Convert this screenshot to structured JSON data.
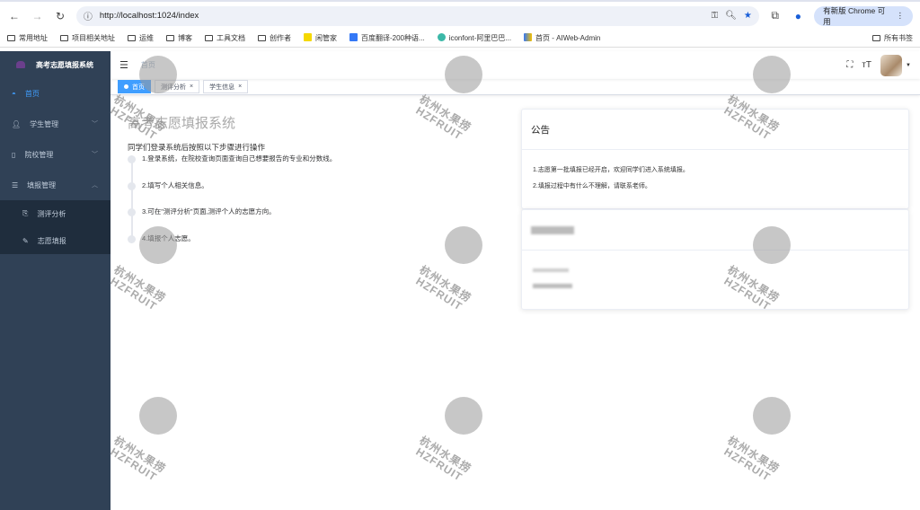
{
  "browser": {
    "url": "http://localhost:1024/index",
    "update_label": "有新版 Chrome 可用",
    "bookmarks": [
      "常用地址",
      "项目相关地址",
      "运维",
      "博客",
      "工具文档",
      "创作者",
      "闲管家",
      "百度翻译-200种语...",
      "iconfont-阿里巴巴...",
      "首页 - AIWeb-Admin"
    ],
    "all_bookmarks": "所有书签"
  },
  "sidebar": {
    "title": "高考志愿填报系统",
    "items": [
      {
        "label": "首页"
      },
      {
        "label": "学生管理"
      },
      {
        "label": "院校管理"
      },
      {
        "label": "填报管理"
      }
    ],
    "sub_items": [
      {
        "label": "测评分析"
      },
      {
        "label": "志愿填报"
      }
    ]
  },
  "header": {
    "breadcrumb": "首页"
  },
  "tags": [
    {
      "label": "首页"
    },
    {
      "label": "测评分析"
    },
    {
      "label": "学生信息"
    }
  ],
  "main": {
    "title": "高考志愿填报系统",
    "intro": "同学们登录系统后按照以下步骤进行操作",
    "steps": [
      "1.登录系统，在院校查询页面查询自己想要报告的专业和分数线。",
      "2.填写个人相关信息。",
      "3.可在\"测评分析\"页面,测评个人的志愿方向。",
      "4.填报个人志愿。"
    ]
  },
  "notice": {
    "title": "公告",
    "lines": [
      "1.志愿第一批填报已经开启，欢迎同学们进入系统填报。",
      "2.填报过程中有什么不理解，请联系老师。"
    ]
  },
  "watermark": {
    "cn": "杭州水果捞",
    "en": "HZFRUIT"
  },
  "colors": {
    "sidebar": "#304156",
    "accent": "#409eff"
  }
}
